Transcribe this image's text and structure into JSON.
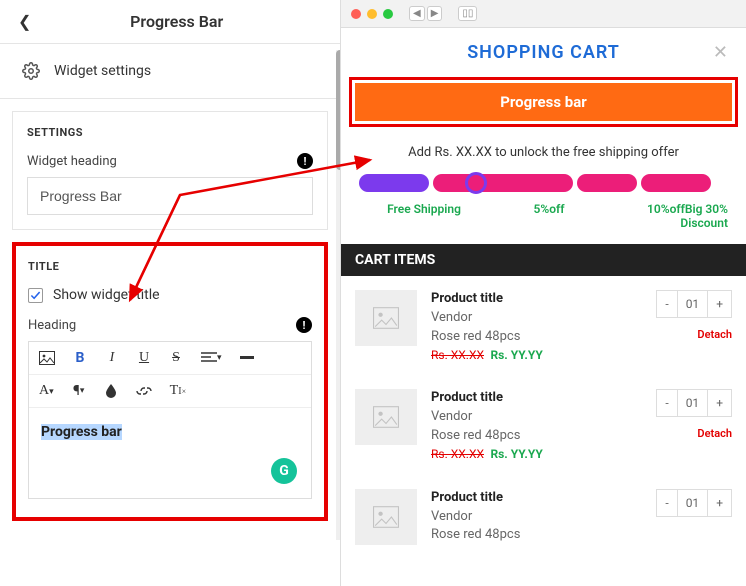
{
  "header": {
    "title": "Progress Bar"
  },
  "widget_settings_label": "Widget settings",
  "settings": {
    "heading": "SETTINGS",
    "field_label": "Widget heading",
    "field_value": "Progress Bar"
  },
  "title_section": {
    "heading": "TITLE",
    "checkbox_label": "Show widget title",
    "field_label": "Heading",
    "editor_value": "Progress bar"
  },
  "cart": {
    "title": "SHOPPING CART",
    "banner": "Progress bar",
    "unlock_text": "Add Rs. XX.XX to unlock the free shipping offer",
    "tiers": [
      "Free Shipping",
      "5%off",
      "10%offBig 30% Discount"
    ],
    "items_header": "CART ITEMS",
    "items": [
      {
        "title": "Product title",
        "vendor": "Vendor",
        "variant": "Rose red 48pcs",
        "old": "Rs. XX.XX",
        "new": "Rs. YY.YY",
        "qty": "01",
        "detach": "Detach"
      },
      {
        "title": "Product title",
        "vendor": "Vendor",
        "variant": "Rose red 48pcs",
        "old": "Rs. XX.XX",
        "new": "Rs. YY.YY",
        "qty": "01",
        "detach": "Detach"
      },
      {
        "title": "Product title",
        "vendor": "Vendor",
        "variant": "Rose red 48pcs",
        "old": "",
        "new": "",
        "qty": "01",
        "detach": ""
      }
    ]
  }
}
